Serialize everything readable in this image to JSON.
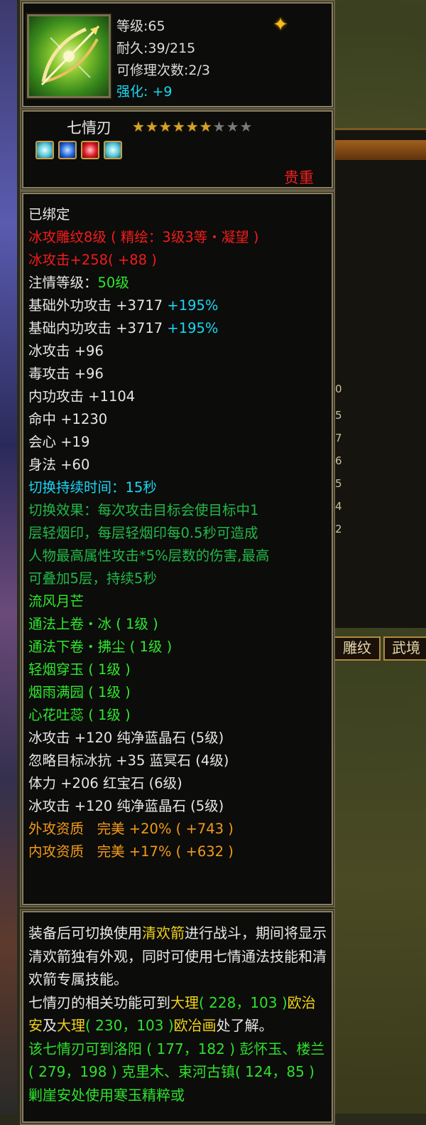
{
  "header": {
    "level": "等级:65",
    "durability": "耐久:39/215",
    "repairs": "可修理次数:2/3",
    "enhance_label": "强化: ",
    "enhance_value": "+9",
    "badge_icon": "flame-badge-icon"
  },
  "item": {
    "name": "七情刃",
    "stars_filled": 6,
    "stars_total": 9,
    "rarity": "贵重",
    "gems": [
      "ice-gem-icon",
      "blue-gem-icon",
      "red-gem-icon",
      "ice-gem-icon"
    ]
  },
  "attributes": {
    "bound": "已绑定",
    "carve": "冰攻雕纹8级 ( 精绘：3级3等・凝望 )",
    "carve_bonus_label": "冰攻击+258",
    "carve_bonus_extra": "( +88 )",
    "devotion_label": "注情等级：",
    "devotion_value": "50级",
    "base_ext_label": "基础外功攻击 +3717 ",
    "base_ext_pct": "+195%",
    "base_int_label": "基础内功攻击 +3717 ",
    "base_int_pct": "+195%",
    "ice_attack": "冰攻击 +96",
    "poison_attack": "毒攻击 +96",
    "internal_attack": "内功攻击 +1104",
    "hit": "命中 +1230",
    "crit": "会心 +19",
    "agility": "身法 +60",
    "switch_duration": "切换持续时间：15秒",
    "switch_effect": [
      "切换效果：每次攻击目标会使目标中1",
      "层轻烟印，每层轻烟印每0.5秒可造成",
      "人物最高属性攻击*5%层数的伤害,最高",
      "可叠加5层，持续5秒"
    ],
    "skills": [
      "流风月芒",
      "通法上卷・冰 ( 1级 )",
      "通法下卷・拂尘 ( 1级 )",
      "轻烟穿玉 ( 1级 )",
      "烟雨满园 ( 1级 )",
      "心花吐蕊 ( 1级 )"
    ],
    "gem_lines": [
      "冰攻击 +120 纯净蓝晶石 (5级)",
      "忽略目标冰抗 +35 蓝冥石 (4级)",
      "体力 +206 红宝石 (6级)",
      "冰攻击 +120 纯净蓝晶石 (5级)"
    ],
    "ext_quality": "外攻资质   完美 +20% ( +743 )",
    "int_quality": "内攻资质   完美 +17% ( +632 )"
  },
  "description": {
    "p1_a": "装备后可切换使用",
    "p1_b": "清欢箭",
    "p1_c": "进行战斗，期间将显示清欢箭独有外观，同时可使用七情通法技能和清欢箭专属技能。",
    "p2_a": "七情刃的相关功能可到",
    "p2_b": "大理",
    "p2_c": "( 228，103 )",
    "p2_d": "欧治安",
    "p2_e": "及",
    "p2_f": "大理",
    "p2_g": "( 230，103 )",
    "p2_h": "欧冶画",
    "p2_i": "处了解。",
    "p3": "该七情刃可到洛阳 ( 177，182 ) 彭怀玉、楼兰 ( 279，198 ) 克里木、束河古镇( 124，85 ) 剿崖安处使用寒玉精粹或"
  },
  "background": {
    "right_tabs": [
      "雕纹",
      "武境"
    ],
    "right_numbers": [
      "0",
      "5",
      "7",
      "6",
      "5",
      "4",
      "2"
    ]
  },
  "colors": {
    "panel_bg": "#0c0c0a",
    "border": "#8a8060",
    "red": "#f21c1c",
    "green": "#2ee82e",
    "cyan": "#1ad6f4",
    "orange": "#f29a1a",
    "gold_star": "#d4a428"
  }
}
